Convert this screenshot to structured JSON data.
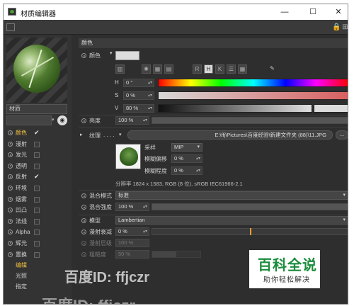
{
  "window": {
    "title": "材质编辑器",
    "minimize": "—",
    "maximize": "☐",
    "close": "✕"
  },
  "toolbar": {
    "lock_icon": "lock-icon",
    "pin_icon": "pin-icon"
  },
  "preview": {
    "material_name": "材质"
  },
  "channels": [
    {
      "label": "颜色",
      "checked": true,
      "active": true
    },
    {
      "label": "漫射",
      "checked": false
    },
    {
      "label": "发光",
      "checked": false
    },
    {
      "label": "透明",
      "checked": false
    },
    {
      "label": "反射",
      "checked": true
    },
    {
      "label": "环境",
      "checked": false
    },
    {
      "label": "烟雾",
      "checked": false
    },
    {
      "label": "凹凸",
      "checked": false
    },
    {
      "label": "法线",
      "checked": false
    },
    {
      "label": "Alpha",
      "checked": false
    },
    {
      "label": "辉光",
      "checked": false
    },
    {
      "label": "置换",
      "checked": false
    }
  ],
  "extra_channels": [
    {
      "label": "编辑",
      "active": true
    },
    {
      "label": "光照"
    },
    {
      "label": "指定"
    }
  ],
  "color_section": {
    "header": "颜色",
    "color_label": "颜色",
    "hsv_h": "0 °",
    "hsv_s": "0 %",
    "hsv_v": "80 %",
    "h_label": "H",
    "s_label": "S",
    "v_label": "V",
    "value_fraction": 0.8,
    "brightness_label": "亮度",
    "brightness_value": "100 %",
    "brightness_fraction": 1.0
  },
  "texture": {
    "label": "纹理",
    "path": "E:\\ffj\\Pictures\\百度经验\\新建文件夹 (88)\\11.JPG",
    "sampling_label": "采样",
    "sampling_value": "MIP",
    "blur_offset_label": "模糊偏移",
    "blur_offset_value": "0 %",
    "blur_scale_label": "模糊程度",
    "blur_scale_value": "0 %",
    "resolution": "分辨率 1824 x 1583, RGB (8 位), sRGB IEC61966-2.1",
    "more_label": "..."
  },
  "mix": {
    "mode_label": "混合模式",
    "mode_value": "标准",
    "strength_label": "混合强度",
    "strength_value": "100 %",
    "strength_fraction": 1.0
  },
  "model": {
    "model_label": "模型",
    "model_value": "Lambertian",
    "diffuse_falloff_label": "漫射衰减",
    "diffuse_falloff_value": "0 %",
    "diffuse_falloff_fraction": 0.5,
    "diffuse_level_label": "漫射层级",
    "diffuse_level_value": "100 %",
    "roughness_label": "粗糙度",
    "roughness_value": "50 %"
  },
  "watermarks": {
    "line1": "百度ID: ffjczr",
    "line2": "百度ID: ffjczr"
  },
  "badge": {
    "big": "百科全说",
    "small": "助你轻松解决",
    "color": "#1a8c3c"
  }
}
